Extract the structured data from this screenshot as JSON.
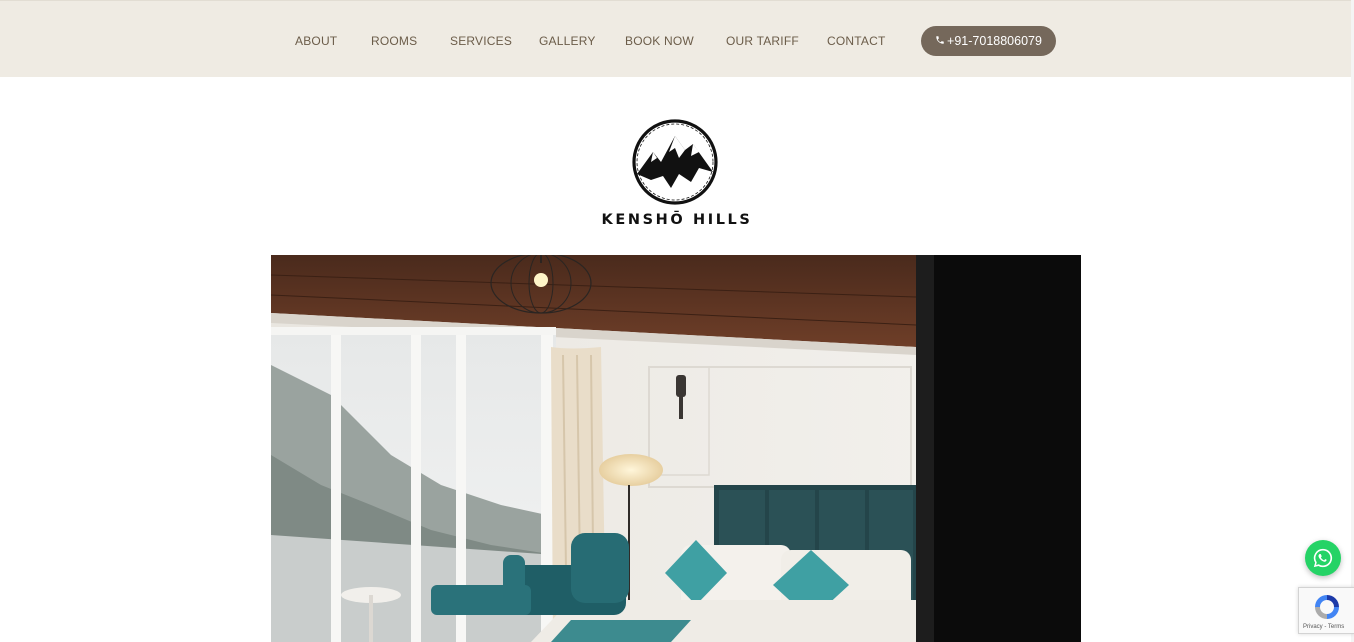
{
  "nav": {
    "items": [
      {
        "label": "ABOUT"
      },
      {
        "label": "ROOMS"
      },
      {
        "label": "SERVICES"
      },
      {
        "label": "GALLERY"
      },
      {
        "label": "BOOK NOW"
      },
      {
        "label": "OUR TARIFF"
      },
      {
        "label": "CONTACT"
      }
    ],
    "phone": "+91-7018806079"
  },
  "brand": {
    "name": "KENSHŌ HILLS"
  },
  "widgets": {
    "recaptcha_links": "Privacy - Terms"
  },
  "icons": {
    "phone": "phone-icon",
    "whatsapp": "whatsapp-icon",
    "recaptcha": "recaptcha-icon"
  },
  "colors": {
    "topbar_bg": "#efebe3",
    "nav_text": "#6b5c49",
    "phone_button": "#75685b",
    "whatsapp": "#25d366"
  }
}
